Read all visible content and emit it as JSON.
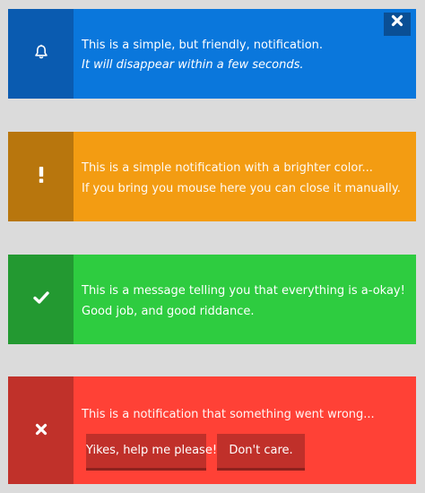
{
  "notifications": [
    {
      "type": "info",
      "icon": "bell-icon",
      "color": "#0a77dc",
      "line1": "This is a simple, but friendly, notification.",
      "line2": "It will disappear within a few seconds.",
      "close_icon": "close-icon"
    },
    {
      "type": "warning",
      "icon": "exclamation-icon",
      "color": "#f39c12",
      "line1": "This is a simple notification with a brighter color...",
      "line2": "If you bring you mouse here you can close it manually."
    },
    {
      "type": "success",
      "icon": "checkmark-icon",
      "color": "#2ecc40",
      "line1": "This is a message telling you that everything is a-okay!",
      "line2": "Good job, and good riddance."
    },
    {
      "type": "error",
      "icon": "x-icon",
      "color": "#ff4136",
      "line1": "This is a notification that something went wrong...",
      "buttons": [
        {
          "label": "Yikes, help me please!"
        },
        {
          "label": "Don't care."
        }
      ]
    }
  ]
}
